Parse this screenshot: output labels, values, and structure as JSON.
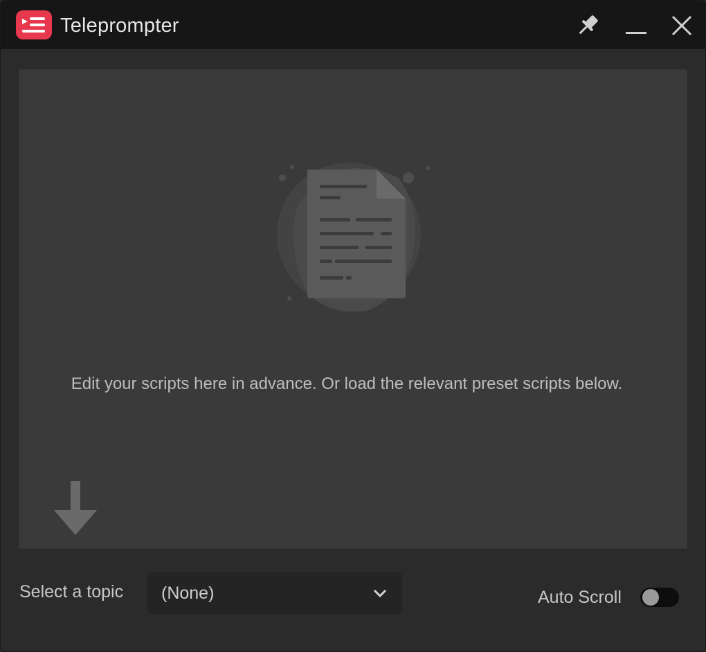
{
  "window": {
    "title": "Teleprompter"
  },
  "titlebar": {
    "icons": [
      "teleprompter-logo-icon",
      "pin-icon",
      "minimize-icon",
      "close-icon"
    ]
  },
  "editor": {
    "hint": "Edit your scripts here in advance. Or load the relevant preset scripts below.",
    "icons": [
      "document-illustration-icon",
      "down-arrow-icon"
    ]
  },
  "footer": {
    "topic_label": "Select a topic",
    "topic_value": "(None)",
    "auto_scroll_label": "Auto Scroll",
    "auto_scroll_on": false
  },
  "colors": {
    "accent": "#e8384d",
    "titlebar_bg": "#161616",
    "window_bg": "#2b2b2b",
    "editor_bg": "#3a3a3a"
  }
}
